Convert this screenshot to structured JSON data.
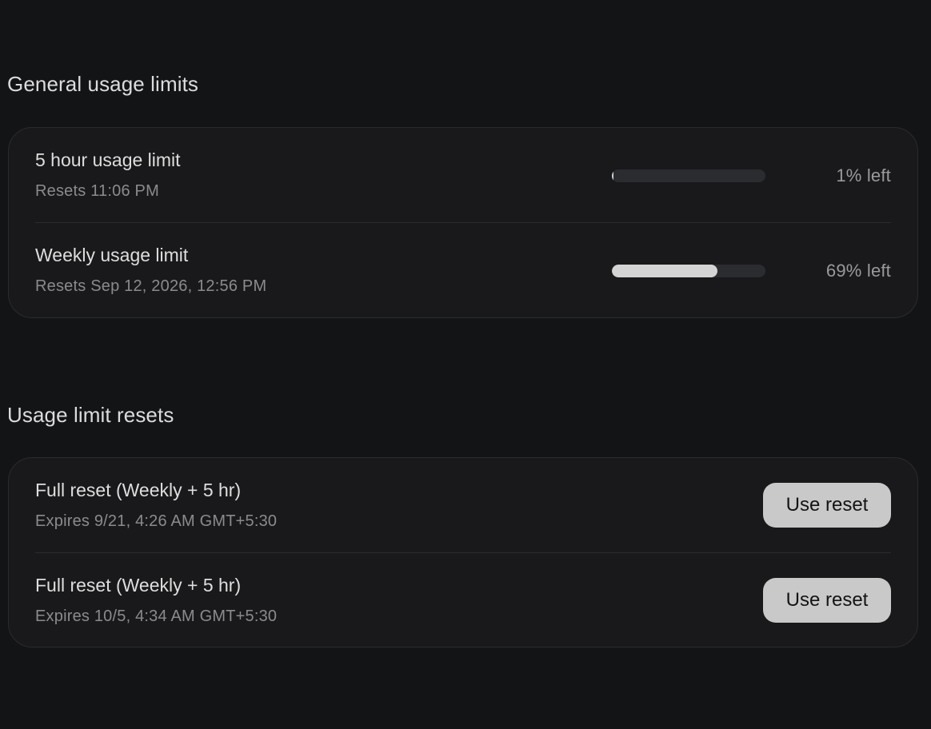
{
  "general": {
    "title": "General usage limits",
    "limits": [
      {
        "title": "5 hour usage limit",
        "reset": "Resets 11:06 PM",
        "percent_left": "1% left",
        "fill_fraction": 0.01
      },
      {
        "title": "Weekly usage limit",
        "reset": "Resets Sep 12, 2026, 12:56 PM",
        "percent_left": "69% left",
        "fill_fraction": 0.69
      }
    ]
  },
  "resets": {
    "title": "Usage limit resets",
    "items": [
      {
        "title": "Full reset (Weekly + 5 hr)",
        "expires": "Expires 9/21, 4:26 AM GMT+5:30",
        "button": "Use reset"
      },
      {
        "title": "Full reset (Weekly + 5 hr)",
        "expires": "Expires 10/5, 4:34 AM GMT+5:30",
        "button": "Use reset"
      }
    ]
  },
  "colors": {
    "background": "#131416",
    "card": "#19191b",
    "bar_fill": "#d4d4d4",
    "bar_track": "#2b2c2f",
    "button": "#c9c9c9"
  }
}
